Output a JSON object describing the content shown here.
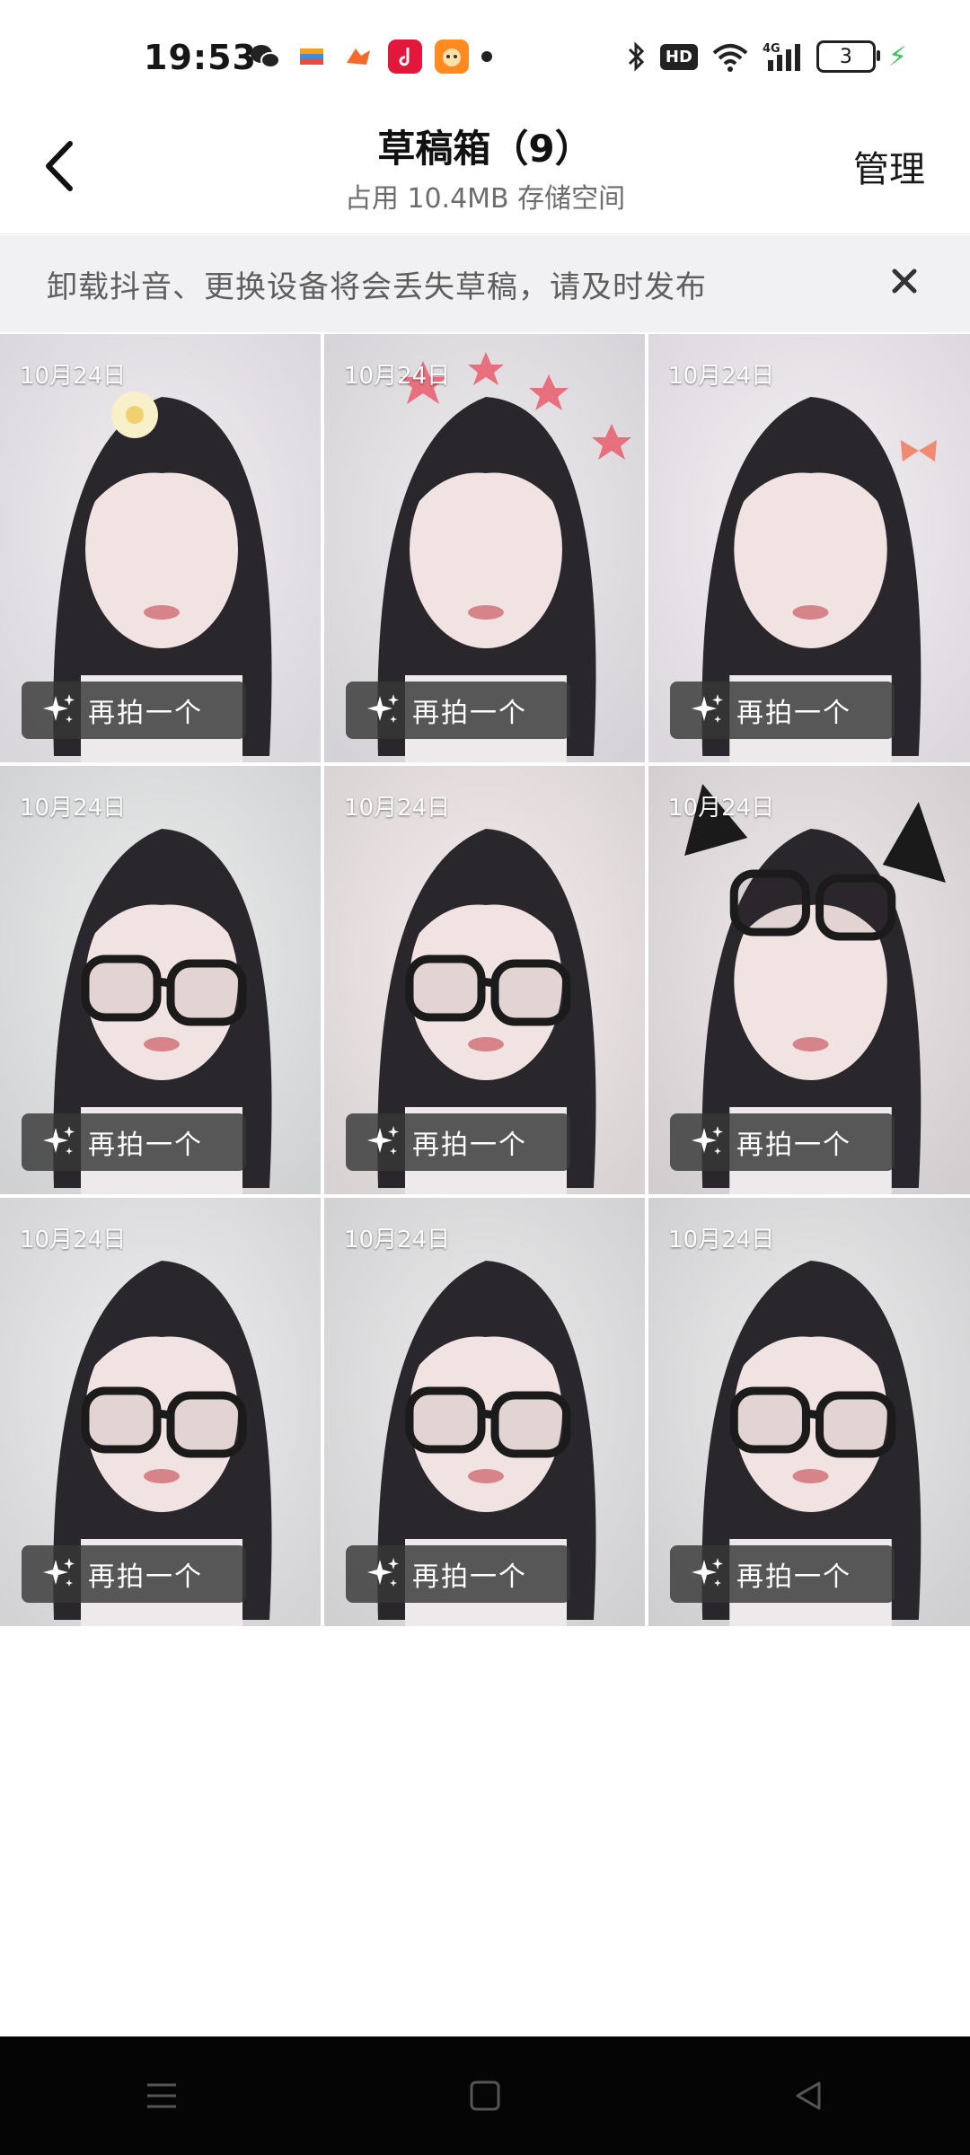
{
  "status_bar": {
    "time": "19:53",
    "hd": "HD",
    "battery_level": "3",
    "app_icons": [
      "wechat-icon",
      "wallet-icon",
      "game-icon",
      "music-icon",
      "mascot-app-icon"
    ]
  },
  "header": {
    "title": "草稿箱（9）",
    "subtitle": "占用 10.4MB 存储空间",
    "manage_label": "管理"
  },
  "notice": {
    "text": "卸载抖音、更换设备将会丢失草稿，请及时发布"
  },
  "drafts": [
    {
      "date": "10月24日",
      "action": "再拍一个",
      "accessory": "flower"
    },
    {
      "date": "10月24日",
      "action": "再拍一个",
      "accessory": "stars"
    },
    {
      "date": "10月24日",
      "action": "再拍一个",
      "accessory": "bow"
    },
    {
      "date": "10月24日",
      "action": "再拍一个",
      "accessory": "glasses"
    },
    {
      "date": "10月24日",
      "action": "再拍一个",
      "accessory": "glasses"
    },
    {
      "date": "10月24日",
      "action": "再拍一个",
      "accessory": "cat-ears"
    },
    {
      "date": "10月24日",
      "action": "再拍一个",
      "accessory": "glasses"
    },
    {
      "date": "10月24日",
      "action": "再拍一个",
      "accessory": "glasses"
    },
    {
      "date": "10月24日",
      "action": "再拍一个",
      "accessory": "glasses"
    }
  ],
  "colors": {
    "accent_text": "#161616",
    "notice_bg": "#f1f1f3",
    "reshoot_bg": "#373737",
    "charging": "#3ac158"
  }
}
